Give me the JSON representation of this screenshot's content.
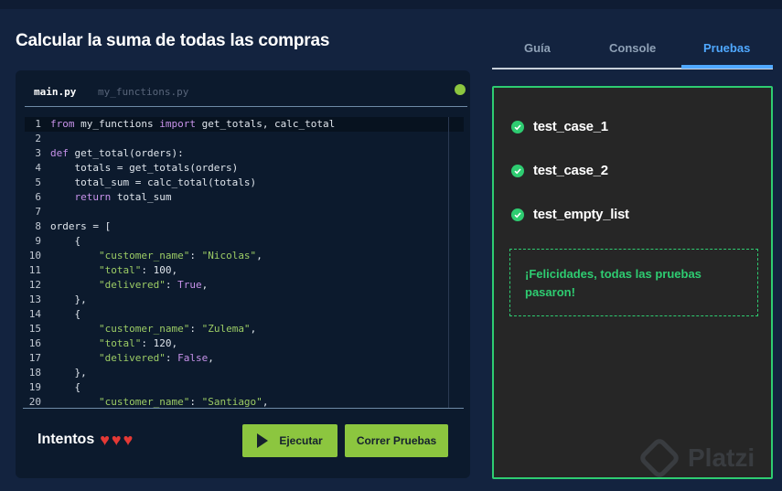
{
  "page": {
    "title": "Calcular la suma de todas las compras"
  },
  "editor": {
    "files": [
      {
        "name": "main.py",
        "active": true
      },
      {
        "name": "my_functions.py",
        "active": false
      }
    ],
    "status_color": "#8cc63f",
    "code_lines": [
      {
        "n": "1",
        "html": "<span class=\"kw\">from</span> my_functions <span class=\"kw\">import</span> get_totals, calc_total"
      },
      {
        "n": "2",
        "html": ""
      },
      {
        "n": "3",
        "html": "<span class=\"kw\">def</span> get_total(orders):"
      },
      {
        "n": "4",
        "html": "    totals = get_totals(orders)"
      },
      {
        "n": "5",
        "html": "    total_sum = calc_total(totals)"
      },
      {
        "n": "6",
        "html": "    <span class=\"kw\">return</span> total_sum"
      },
      {
        "n": "7",
        "html": ""
      },
      {
        "n": "8",
        "html": "orders = ["
      },
      {
        "n": "9",
        "html": "    {"
      },
      {
        "n": "10",
        "html": "        <span class=\"str\">\"customer_name\"</span>: <span class=\"str\">\"Nicolas\"</span>,"
      },
      {
        "n": "11",
        "html": "        <span class=\"str\">\"total\"</span>: 100,"
      },
      {
        "n": "12",
        "html": "        <span class=\"str\">\"delivered\"</span>: <span class=\"kw\">True</span>,"
      },
      {
        "n": "13",
        "html": "    },"
      },
      {
        "n": "14",
        "html": "    {"
      },
      {
        "n": "15",
        "html": "        <span class=\"str\">\"customer_name\"</span>: <span class=\"str\">\"Zulema\"</span>,"
      },
      {
        "n": "16",
        "html": "        <span class=\"str\">\"total\"</span>: 120,"
      },
      {
        "n": "17",
        "html": "        <span class=\"str\">\"delivered\"</span>: <span class=\"kw\">False</span>,"
      },
      {
        "n": "18",
        "html": "    },"
      },
      {
        "n": "19",
        "html": "    {"
      },
      {
        "n": "20",
        "html": "        <span class=\"str\">\"customer_name\"</span>: <span class=\"str\">\"Santiago\"</span>,"
      }
    ]
  },
  "footer": {
    "attempts_label": "Intentos",
    "hearts": [
      "♥",
      "♥",
      "♥"
    ],
    "run_label": "Ejecutar",
    "tests_label": "Correr Pruebas"
  },
  "tabs": [
    {
      "label": "Guía",
      "active": false
    },
    {
      "label": "Console",
      "active": false
    },
    {
      "label": "Pruebas",
      "active": true
    }
  ],
  "results": {
    "tests": [
      {
        "name": "test_case_1",
        "status": "passed"
      },
      {
        "name": "test_case_2",
        "status": "passed"
      },
      {
        "name": "test_empty_list",
        "status": "passed"
      }
    ],
    "success_message": "¡Felicidades, todas las pruebas pasaron!"
  },
  "watermark": {
    "text": "Platzi"
  },
  "colors": {
    "accent_green": "#8cc63f",
    "success": "#2ecc71",
    "active_tab": "#4fa8ff",
    "heart": "#e53935"
  }
}
